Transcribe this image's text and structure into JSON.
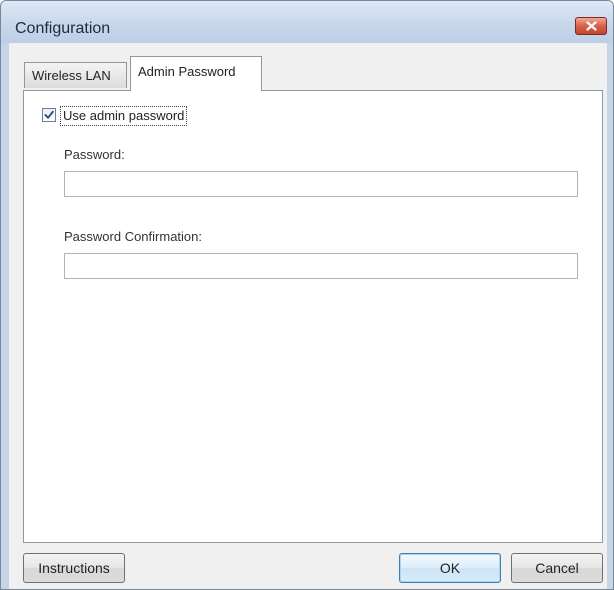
{
  "window": {
    "title": "Configuration"
  },
  "tabs": [
    {
      "label": "Wireless LAN",
      "selected": false
    },
    {
      "label": "Admin Password",
      "selected": true
    }
  ],
  "admin_password": {
    "use_admin_password": {
      "label": "Use admin password",
      "checked": true
    },
    "password": {
      "label": "Password:",
      "value": "",
      "placeholder": ""
    },
    "password_confirmation": {
      "label": "Password Confirmation:",
      "value": "",
      "placeholder": ""
    }
  },
  "buttons": {
    "instructions": "Instructions",
    "ok": "OK",
    "cancel": "Cancel"
  },
  "icons": {
    "close": "close-icon",
    "checkmark": "checkmark-icon"
  },
  "colors": {
    "titlebar": "#c8d8ec",
    "close_button": "#d8604a",
    "ok_button_border": "#3c7fb1",
    "dialog_background": "#f0f0f0"
  }
}
